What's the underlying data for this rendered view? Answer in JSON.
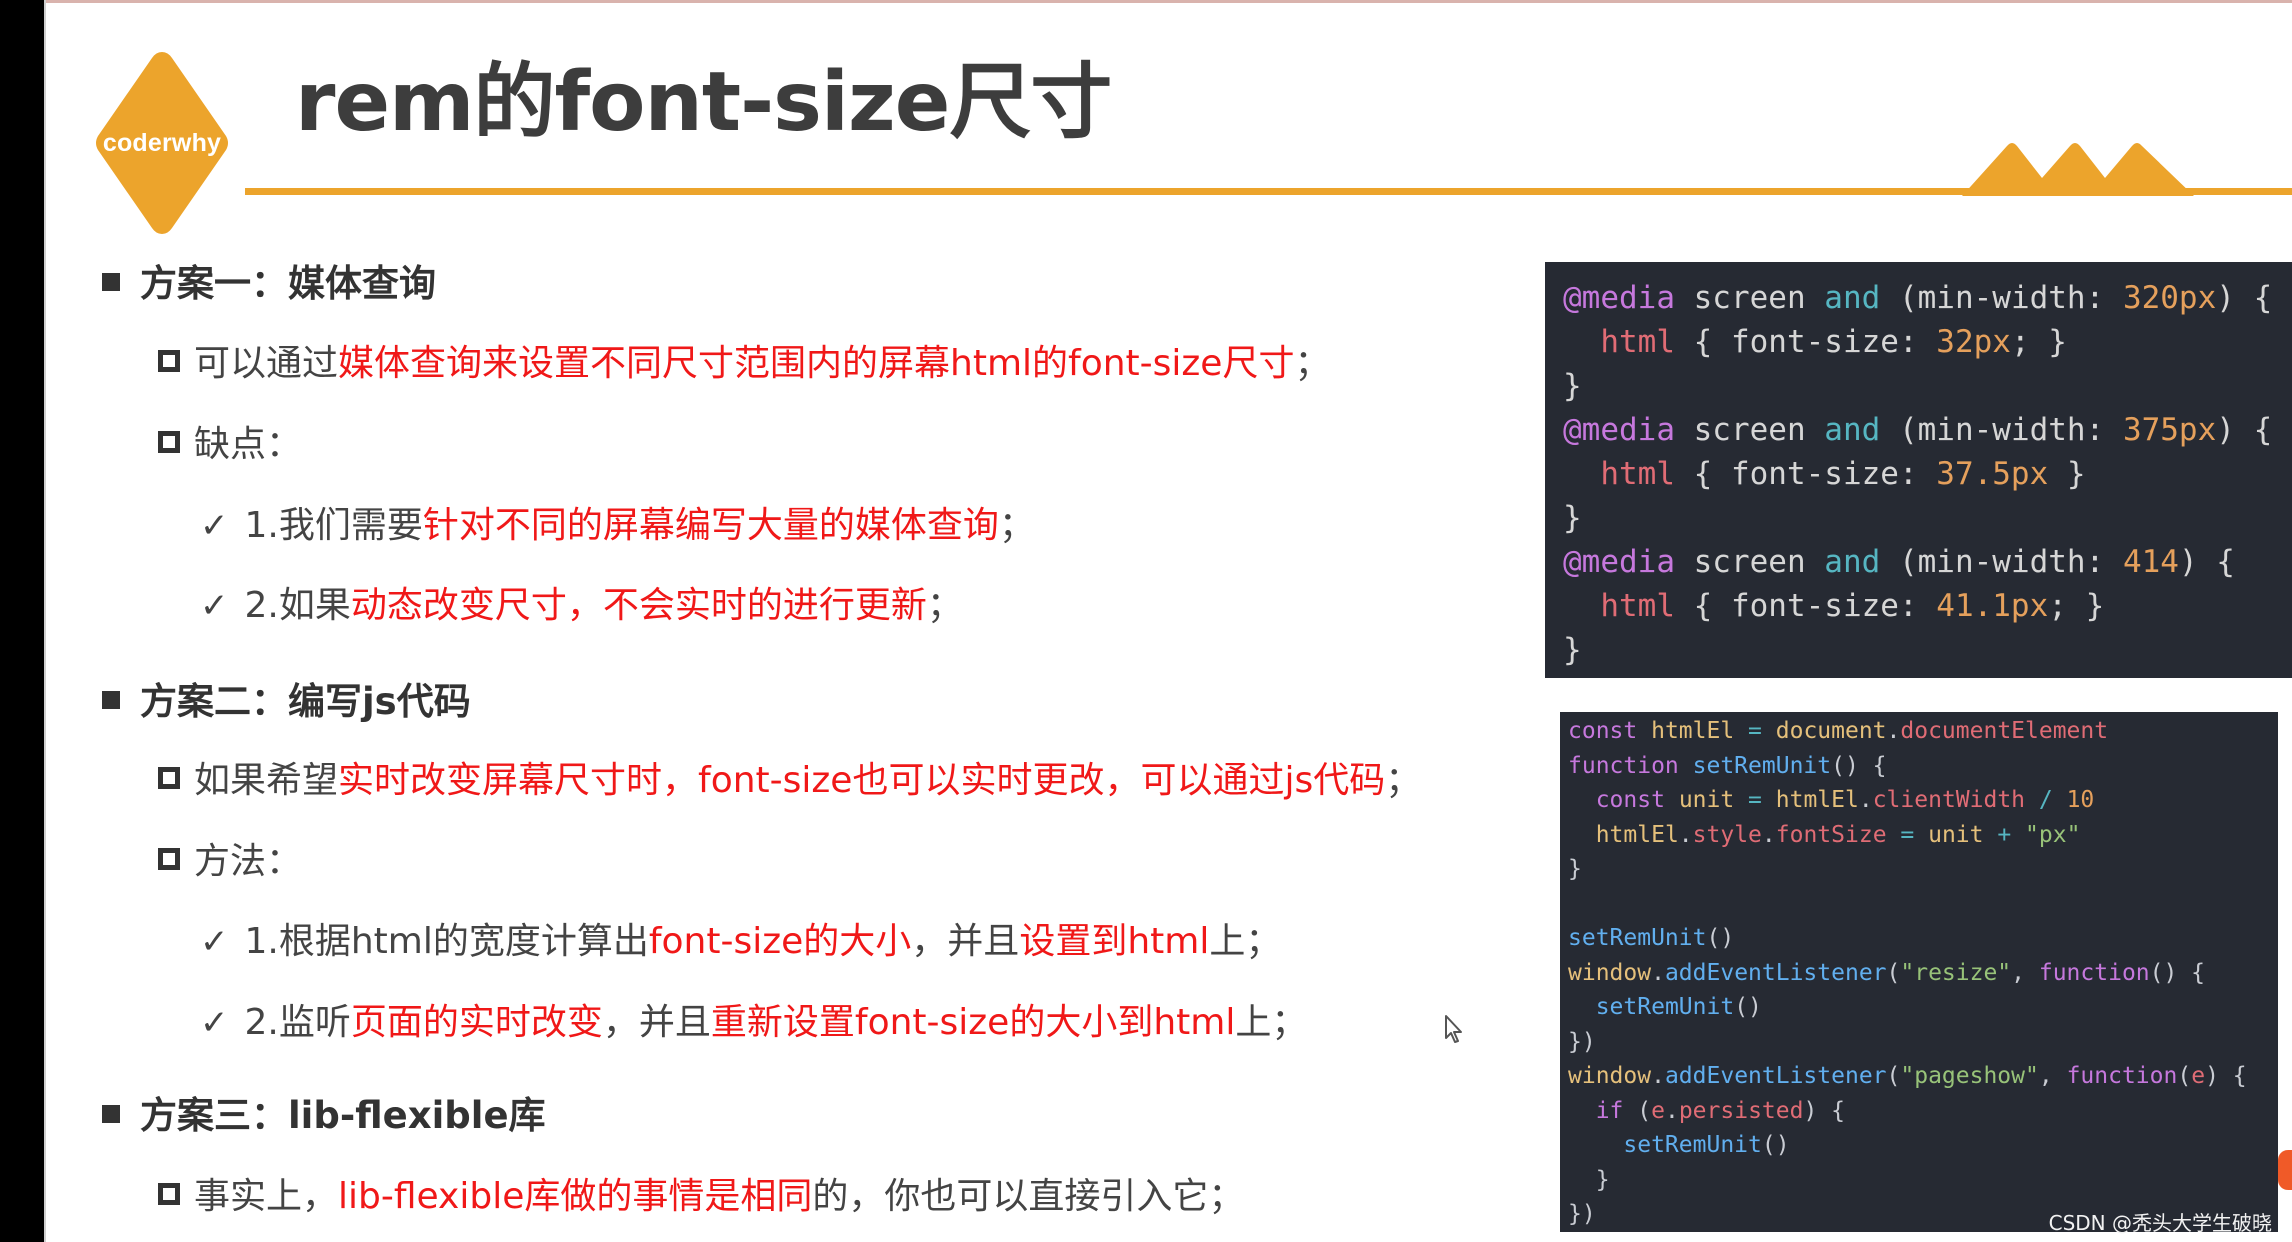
{
  "slide": {
    "logo_text": "coderwhy",
    "title": "rem的font-size尺寸",
    "accent_color": "#eca42c",
    "highlight_color": "#f01818"
  },
  "sections": [
    {
      "heading": "方案一：媒体查询",
      "items": [
        {
          "type": "square",
          "parts": [
            {
              "text": "可以通过",
              "red": false
            },
            {
              "text": "媒体查询来设置不同尺寸范围内的屏幕html的font-size尺寸",
              "red": true
            },
            {
              "text": "；",
              "red": false
            }
          ]
        },
        {
          "type": "square",
          "parts": [
            {
              "text": "缺点：",
              "red": false
            }
          ]
        },
        {
          "type": "check",
          "parts": [
            {
              "text": "1.我们需要",
              "red": false
            },
            {
              "text": "针对不同的屏幕编写大量的媒体查询",
              "red": true
            },
            {
              "text": "；",
              "red": false
            }
          ]
        },
        {
          "type": "check",
          "parts": [
            {
              "text": "2.如果",
              "red": false
            },
            {
              "text": "动态改变尺寸，不会实时的进行更新",
              "red": true
            },
            {
              "text": "；",
              "red": false
            }
          ]
        }
      ]
    },
    {
      "heading": "方案二：编写js代码",
      "items": [
        {
          "type": "square",
          "parts": [
            {
              "text": "如果希望",
              "red": false
            },
            {
              "text": "实时改变屏幕尺寸时，font-size也可以实时更改，可以通过js代码",
              "red": true
            },
            {
              "text": "；",
              "red": false
            }
          ]
        },
        {
          "type": "square",
          "parts": [
            {
              "text": "方法：",
              "red": false
            }
          ]
        },
        {
          "type": "check",
          "parts": [
            {
              "text": "1.根据html的宽度计算出",
              "red": false
            },
            {
              "text": "font-size的大小",
              "red": true
            },
            {
              "text": "，并且",
              "red": false
            },
            {
              "text": "设置到html",
              "red": true
            },
            {
              "text": "上；",
              "red": false
            }
          ]
        },
        {
          "type": "check",
          "parts": [
            {
              "text": "2.监听",
              "red": false
            },
            {
              "text": "页面的实时改变",
              "red": true
            },
            {
              "text": "，并且",
              "red": false
            },
            {
              "text": "重新设置font-size的大小到html",
              "red": true
            },
            {
              "text": "上；",
              "red": false
            }
          ]
        }
      ]
    },
    {
      "heading": "方案三：lib-flexible库",
      "items": [
        {
          "type": "square",
          "parts": [
            {
              "text": "事实上，",
              "red": false
            },
            {
              "text": "lib-flexible库做的事情是相同",
              "red": true
            },
            {
              "text": "的，你也可以直接引入它；",
              "red": false
            }
          ]
        }
      ]
    }
  ],
  "code_media": [
    [
      [
        "t-at",
        "@media"
      ],
      [
        "t-prop",
        " screen "
      ],
      [
        "t-and",
        "and"
      ],
      [
        "t-prop",
        " (min-width: "
      ],
      [
        "t-num",
        "320px"
      ],
      [
        "t-prop",
        ") {"
      ]
    ],
    [
      [
        "t-prop",
        "  "
      ],
      [
        "t-sel",
        "html"
      ],
      [
        "t-prop",
        " { font-size: "
      ],
      [
        "t-num",
        "32px"
      ],
      [
        "t-prop",
        "; }"
      ]
    ],
    [
      [
        "t-prop",
        "}"
      ]
    ],
    [
      [
        "t-at",
        "@media"
      ],
      [
        "t-prop",
        " screen "
      ],
      [
        "t-and",
        "and"
      ],
      [
        "t-prop",
        " (min-width: "
      ],
      [
        "t-num",
        "375px"
      ],
      [
        "t-prop",
        ") {"
      ]
    ],
    [
      [
        "t-prop",
        "  "
      ],
      [
        "t-sel",
        "html"
      ],
      [
        "t-prop",
        " { font-size: "
      ],
      [
        "t-num",
        "37.5px"
      ],
      [
        "t-prop",
        " }"
      ]
    ],
    [
      [
        "t-prop",
        "}"
      ]
    ],
    [
      [
        "t-at",
        "@media"
      ],
      [
        "t-prop",
        " screen "
      ],
      [
        "t-and",
        "and"
      ],
      [
        "t-prop",
        " (min-width: "
      ],
      [
        "t-num",
        "414"
      ],
      [
        "t-prop",
        ") {"
      ]
    ],
    [
      [
        "t-prop",
        "  "
      ],
      [
        "t-sel",
        "html"
      ],
      [
        "t-prop",
        " { font-size: "
      ],
      [
        "t-num",
        "41.1px"
      ],
      [
        "t-prop",
        "; }"
      ]
    ],
    [
      [
        "t-prop",
        "}"
      ]
    ]
  ],
  "code_js": [
    [
      [
        "t-kw",
        "const"
      ],
      [
        "t-pun",
        " "
      ],
      [
        "t-var",
        "htmlEl"
      ],
      [
        "t-op",
        " = "
      ],
      [
        "t-var",
        "document"
      ],
      [
        "t-pun",
        "."
      ],
      [
        "t-mem",
        "documentElement"
      ]
    ],
    [
      [
        "t-kw",
        "function"
      ],
      [
        "t-pun",
        " "
      ],
      [
        "t-fn",
        "setRemUnit"
      ],
      [
        "t-pun",
        "() {"
      ]
    ],
    [
      [
        "t-pun",
        "  "
      ],
      [
        "t-kw",
        "const"
      ],
      [
        "t-pun",
        " "
      ],
      [
        "t-var",
        "unit"
      ],
      [
        "t-op",
        " = "
      ],
      [
        "t-var",
        "htmlEl"
      ],
      [
        "t-pun",
        "."
      ],
      [
        "t-mem",
        "clientWidth"
      ],
      [
        "t-op",
        " / "
      ],
      [
        "t-num",
        "10"
      ]
    ],
    [
      [
        "t-pun",
        "  "
      ],
      [
        "t-var",
        "htmlEl"
      ],
      [
        "t-pun",
        "."
      ],
      [
        "t-mem",
        "style"
      ],
      [
        "t-pun",
        "."
      ],
      [
        "t-mem",
        "fontSize"
      ],
      [
        "t-op",
        " = "
      ],
      [
        "t-var",
        "unit"
      ],
      [
        "t-op",
        " + "
      ],
      [
        "t-str",
        "\"px\""
      ]
    ],
    [
      [
        "t-pun",
        "}"
      ]
    ],
    [
      [
        "t-pun",
        ""
      ]
    ],
    [
      [
        "t-fn",
        "setRemUnit"
      ],
      [
        "t-pun",
        "()"
      ]
    ],
    [
      [
        "t-var",
        "window"
      ],
      [
        "t-pun",
        "."
      ],
      [
        "t-fn",
        "addEventListener"
      ],
      [
        "t-pun",
        "("
      ],
      [
        "t-str",
        "\"resize\""
      ],
      [
        "t-pun",
        ", "
      ],
      [
        "t-kw",
        "function"
      ],
      [
        "t-pun",
        "() {"
      ]
    ],
    [
      [
        "t-pun",
        "  "
      ],
      [
        "t-fn",
        "setRemUnit"
      ],
      [
        "t-pun",
        "()"
      ]
    ],
    [
      [
        "t-pun",
        "})"
      ]
    ],
    [
      [
        "t-var",
        "window"
      ],
      [
        "t-pun",
        "."
      ],
      [
        "t-fn",
        "addEventListener"
      ],
      [
        "t-pun",
        "("
      ],
      [
        "t-str",
        "\"pageshow\""
      ],
      [
        "t-pun",
        ", "
      ],
      [
        "t-kw",
        "function"
      ],
      [
        "t-pun",
        "("
      ],
      [
        "t-mem",
        "e"
      ],
      [
        "t-pun",
        ") {"
      ]
    ],
    [
      [
        "t-pun",
        "  "
      ],
      [
        "t-kw",
        "if"
      ],
      [
        "t-pun",
        " ("
      ],
      [
        "t-mem",
        "e"
      ],
      [
        "t-pun",
        "."
      ],
      [
        "t-mem",
        "persisted"
      ],
      [
        "t-pun",
        ") {"
      ]
    ],
    [
      [
        "t-pun",
        "    "
      ],
      [
        "t-fn",
        "setRemUnit"
      ],
      [
        "t-pun",
        "()"
      ]
    ],
    [
      [
        "t-pun",
        "  }"
      ]
    ],
    [
      [
        "t-pun",
        "})"
      ]
    ]
  ],
  "watermark": "CSDN @秃头大学生破晓"
}
